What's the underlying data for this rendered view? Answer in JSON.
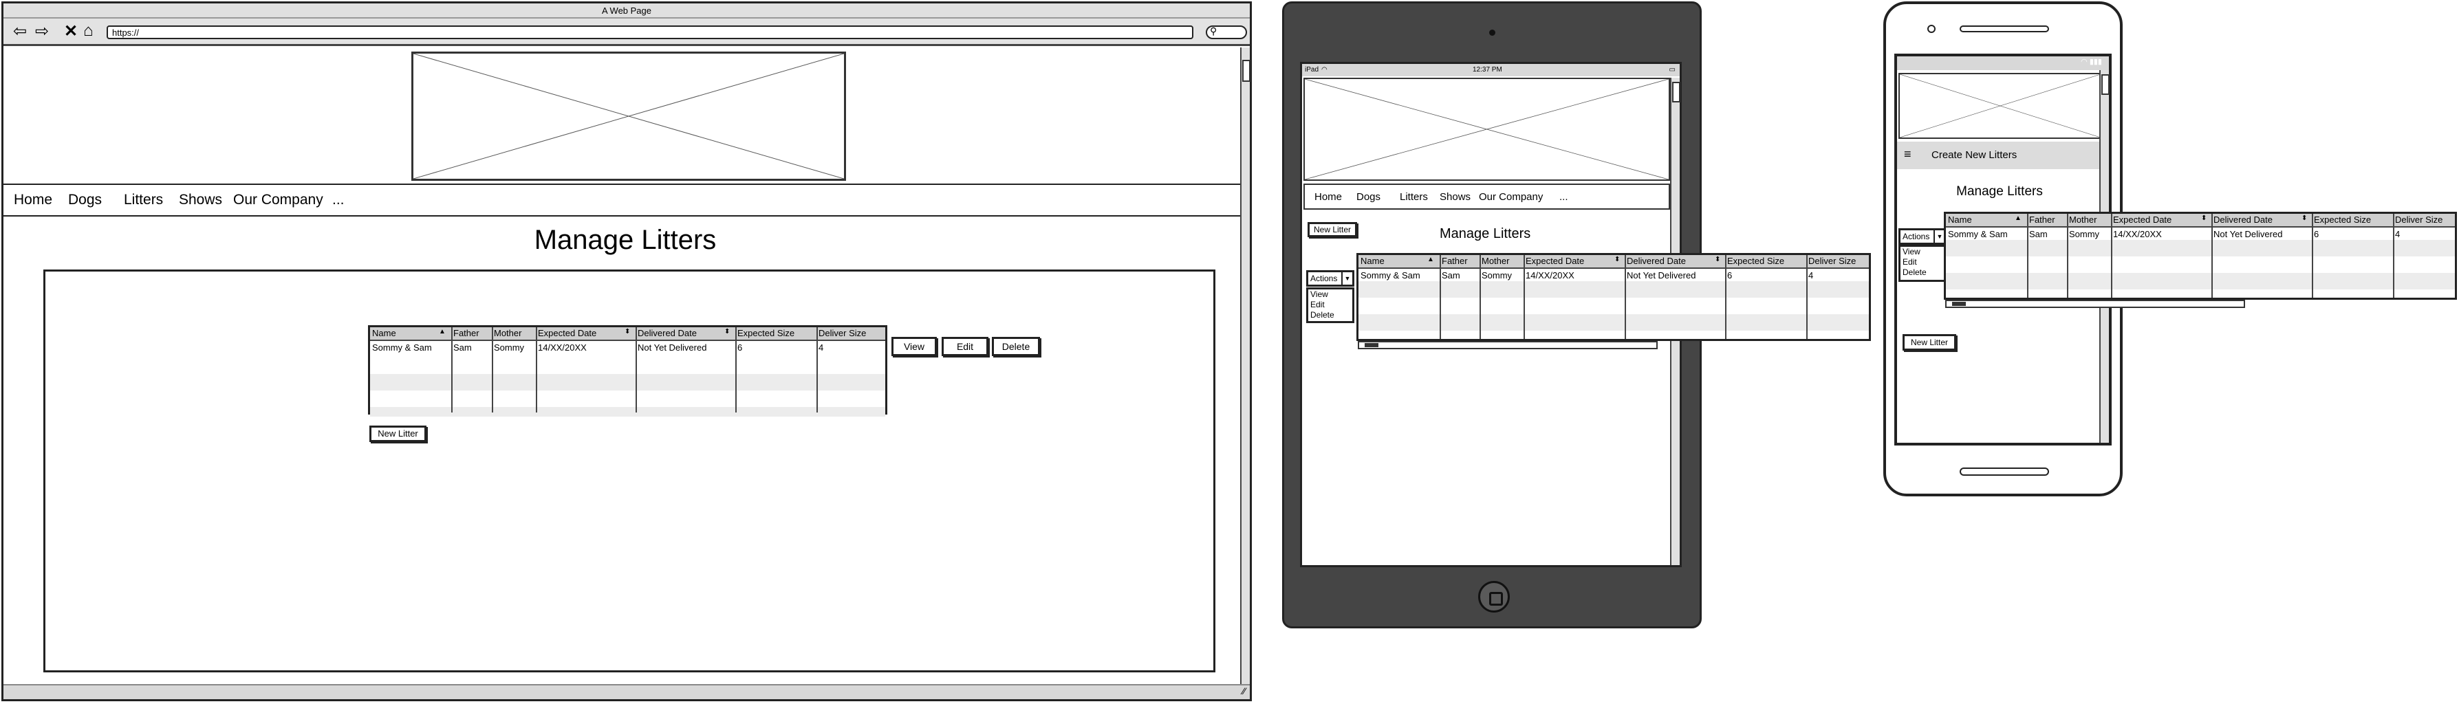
{
  "desktop": {
    "window_title": "A Web Page",
    "nav_icons": [
      "back-arrow-icon",
      "forward-arrow-icon",
      "close-x-icon",
      "home-icon"
    ],
    "url": "https://",
    "nav": [
      "Home",
      "Dogs",
      "Litters",
      "Shows",
      "Our Company",
      "..."
    ],
    "page_title": "Manage Litters",
    "table": {
      "columns": [
        "Name",
        "Father",
        "Mother",
        "Expected Date",
        "Delivered Date",
        "Expected Size",
        "Deliver Size"
      ],
      "rows": [
        [
          "Sommy & Sam",
          "Sam",
          "Sommy",
          "14/XX/20XX",
          "Not Yet Delivered",
          "6",
          "4"
        ]
      ]
    },
    "buttons": {
      "view": "View",
      "edit": "Edit",
      "delete": "Delete",
      "new_litter": "New Litter"
    }
  },
  "tablet": {
    "status_left": "iPad",
    "status_time": "12:37 PM",
    "nav": [
      "Home",
      "Dogs",
      "Litters",
      "Shows",
      "Our Company",
      "..."
    ],
    "new_litter": "New Litter",
    "page_title": "Manage Litters",
    "actions": {
      "label": "Actions",
      "items": [
        "View",
        "Edit",
        "Delete"
      ]
    },
    "table": {
      "columns": [
        "Name",
        "Father",
        "Mother",
        "Expected Date",
        "Delivered Date",
        "Expected Size",
        "Deliver Size"
      ],
      "rows": [
        [
          "Sommy & Sam",
          "Sam",
          "Sommy",
          "14/XX/20XX",
          "Not Yet Delivered",
          "6",
          "4"
        ]
      ]
    }
  },
  "phone": {
    "menu_title": "Create New Litters",
    "page_title": "Manage Litters",
    "actions": {
      "label": "Actions",
      "items": [
        "View",
        "Edit",
        "Delete"
      ]
    },
    "table": {
      "columns": [
        "Name",
        "Father",
        "Mother",
        "Expected Date",
        "Delivered Date",
        "Expected Size",
        "Deliver Size"
      ],
      "rows": [
        [
          "Sommy & Sam",
          "Sam",
          "Sommy",
          "14/XX/20XX",
          "Not Yet Delivered",
          "6",
          "4"
        ]
      ]
    },
    "new_litter": "New Litter"
  },
  "colors": {
    "header_gray": "#cfcfcf",
    "tablet_body": "#454545",
    "stripe": "#ececec"
  }
}
